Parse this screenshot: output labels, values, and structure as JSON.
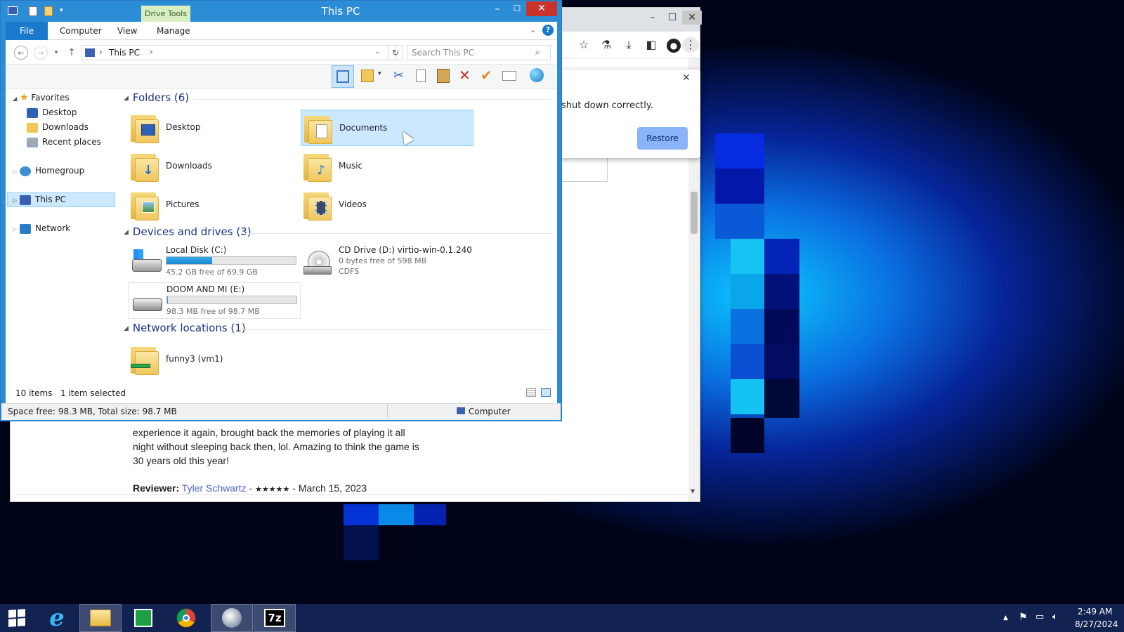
{
  "desktop": {
    "background_color": "#06259a"
  },
  "browser": {
    "restore_bubble": {
      "message": "shut down correctly.",
      "restore_label": "Restore",
      "close_glyph": "✕"
    },
    "toolbar_icons": [
      "star-icon",
      "flask-icon",
      "download-icon",
      "sidebar-icon",
      "profile-icon",
      "menu-dots-icon"
    ],
    "review": {
      "text_lines": [
        "experience it again, brought back the memories of playing it all",
        "night without sleeping back then, lol. Amazing to think the game is",
        "30 years old this year!"
      ],
      "reviewer_label": "Reviewer:",
      "reviewer_name": "Tyler Schwartz",
      "rating": "★★★★★",
      "separator": "-",
      "date": "March 15, 2023"
    }
  },
  "explorer": {
    "window_title": "This PC",
    "context_tab": "Drive Tools",
    "ribbon_tabs": [
      {
        "label": "File",
        "active": true
      },
      {
        "label": "Computer",
        "active": false
      },
      {
        "label": "View",
        "active": false
      },
      {
        "label": "Manage",
        "active": false
      }
    ],
    "address": {
      "crumb": "This PC",
      "separator": "›"
    },
    "search_placeholder": "Search This PC",
    "nav_tree": {
      "favorites_label": "Favorites",
      "favorites": [
        "Desktop",
        "Downloads",
        "Recent places"
      ],
      "homegroup": "Homegroup",
      "this_pc": "This PC",
      "network": "Network"
    },
    "sections": {
      "folders": "Folders (6)",
      "devices": "Devices and drives (3)",
      "network": "Network locations (1)"
    },
    "folders": [
      {
        "name": "Desktop",
        "icon": "desktop-icon"
      },
      {
        "name": "Documents",
        "icon": "documents-icon",
        "selected": true
      },
      {
        "name": "Downloads",
        "icon": "download-arrow-icon"
      },
      {
        "name": "Music",
        "icon": "music-note-icon"
      },
      {
        "name": "Pictures",
        "icon": "picture-icon"
      },
      {
        "name": "Videos",
        "icon": "film-icon"
      }
    ],
    "drives": [
      {
        "name": "Local Disk (C:)",
        "free": "45.2 GB free of 69.9 GB",
        "used_fraction": 0.353
      },
      {
        "name": "CD Drive (D:) virtio-win-0.1.240",
        "free": "0 bytes free of 598 MB",
        "fs": "CDFS"
      },
      {
        "name": "DOOM AND MI (E:)",
        "free": "98.3 MB free of 98.7 MB",
        "used_fraction": 0.004
      }
    ],
    "network_locations": [
      {
        "name": "funny3 (vm1)"
      }
    ],
    "status": {
      "items": "10 items",
      "selected": "1 item selected",
      "space": "Space free: 98.3 MB, Total size: 98.7 MB",
      "location": "Computer"
    }
  },
  "taskbar": {
    "buttons": [
      "start",
      "internet-explorer",
      "file-explorer",
      "store",
      "chrome",
      "vm-viewer",
      "7zip"
    ],
    "sevenzip_label": "7z",
    "time": "2:49 AM",
    "date": "8/27/2024"
  }
}
